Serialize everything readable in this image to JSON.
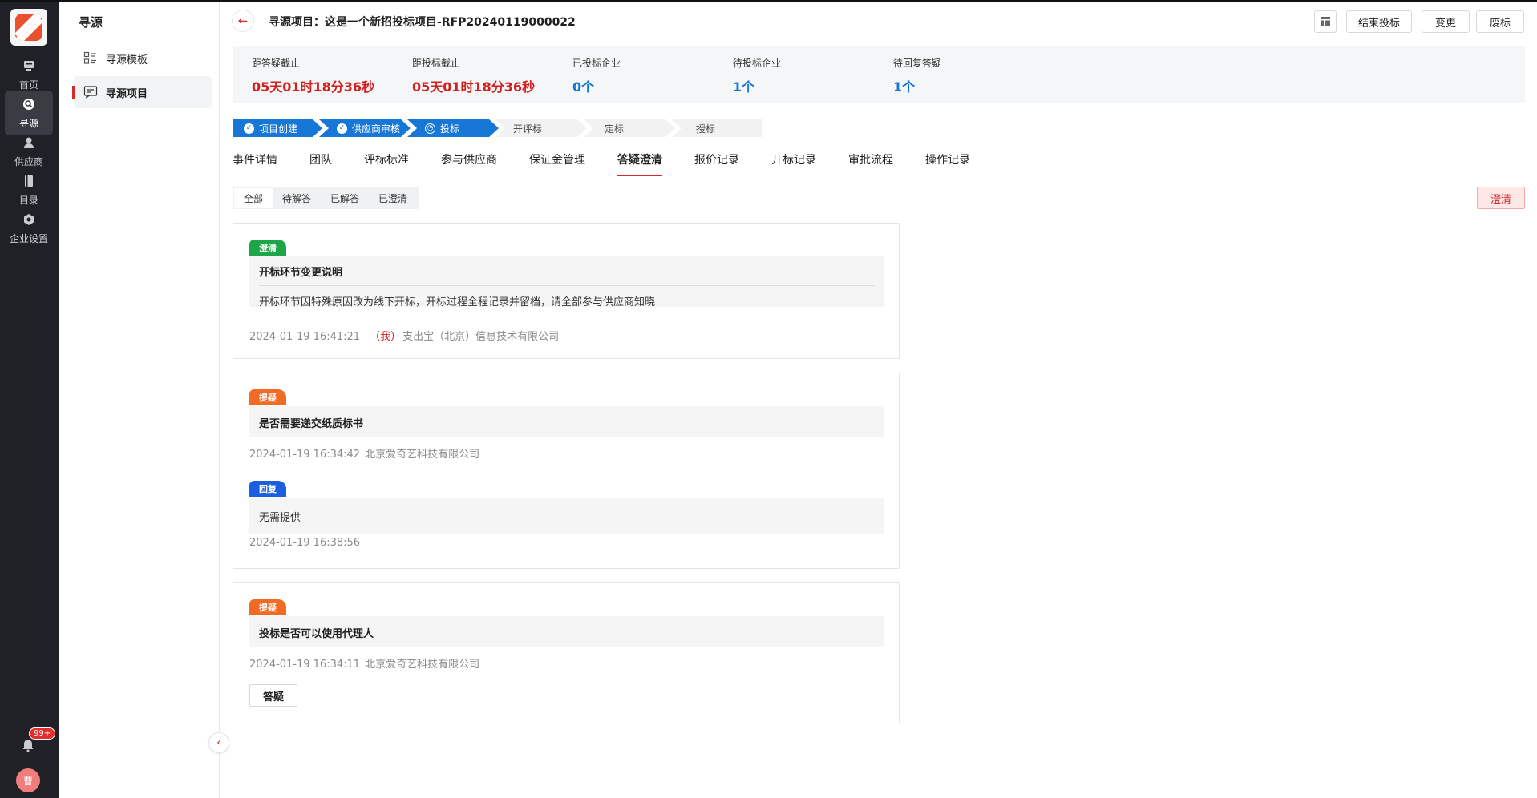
{
  "nav": {
    "items": [
      {
        "label": "首页",
        "icon": "home-icon"
      },
      {
        "label": "寻源",
        "icon": "sourcing-icon"
      },
      {
        "label": "供应商",
        "icon": "supplier-icon"
      },
      {
        "label": "目录",
        "icon": "catalog-icon"
      },
      {
        "label": "企业设置",
        "icon": "settings-icon"
      }
    ],
    "notification_badge": "99+",
    "avatar_text": "曹"
  },
  "sub_sidebar": {
    "title": "寻源",
    "items": [
      {
        "label": "寻源模板"
      },
      {
        "label": "寻源项目"
      }
    ]
  },
  "header": {
    "title": "寻源项目：这是一个新招投标项目-RFP20240119000022",
    "buttons": {
      "end_bid": "结束投标",
      "change": "变更",
      "abandon": "废标"
    }
  },
  "stats": [
    {
      "label": "距答疑截止",
      "value": "05天01时18分36秒",
      "color": "#d21f1f"
    },
    {
      "label": "距投标截止",
      "value": "05天01时18分36秒",
      "color": "#d21f1f"
    },
    {
      "label": "已投标企业",
      "value": "0个",
      "color": "#1677d6"
    },
    {
      "label": "待投标企业",
      "value": "1个",
      "color": "#1677d6"
    },
    {
      "label": "待回复答疑",
      "value": "1个",
      "color": "#1677d6"
    }
  ],
  "steps": [
    {
      "label": "项目创建",
      "status": "done"
    },
    {
      "label": "供应商审核",
      "status": "done"
    },
    {
      "label": "投标",
      "status": "current"
    },
    {
      "label": "开评标",
      "status": "pending"
    },
    {
      "label": "定标",
      "status": "pending"
    },
    {
      "label": "授标",
      "status": "pending"
    }
  ],
  "tabs": [
    {
      "label": "事件详情"
    },
    {
      "label": "团队"
    },
    {
      "label": "评标标准"
    },
    {
      "label": "参与供应商"
    },
    {
      "label": "保证金管理"
    },
    {
      "label": "答疑澄清",
      "active": true
    },
    {
      "label": "报价记录"
    },
    {
      "label": "开标记录"
    },
    {
      "label": "审批流程"
    },
    {
      "label": "操作记录"
    }
  ],
  "filter": {
    "options": [
      "全部",
      "待解答",
      "已解答",
      "已澄清"
    ],
    "selected": "全部"
  },
  "clarify_button": "澄清",
  "cards": [
    {
      "tag": "澄清",
      "title": "开标环节变更说明",
      "body": "开标环节因特殊原因改为线下开标，开标过程全程记录并留档，请全部参与供应商知晓",
      "time": "2024-01-19 16:41:21",
      "me": "（我）",
      "company": "支出宝（北京）信息技术有限公司"
    },
    {
      "tag": "提疑",
      "title": "是否需要递交纸质标书",
      "time": "2024-01-19 16:34:42",
      "company": "北京爱奇艺科技有限公司",
      "reply": {
        "tag": "回复",
        "body": "无需提供",
        "time": "2024-01-19 16:38:56"
      }
    },
    {
      "tag": "提疑",
      "title": "投标是否可以使用代理人",
      "time": "2024-01-19 16:34:11",
      "company": "北京爱奇艺科技有限公司",
      "action": "答疑"
    }
  ],
  "colors": {
    "accent": "#d82a2a",
    "blue": "#1677d6",
    "rail": "#202126"
  }
}
